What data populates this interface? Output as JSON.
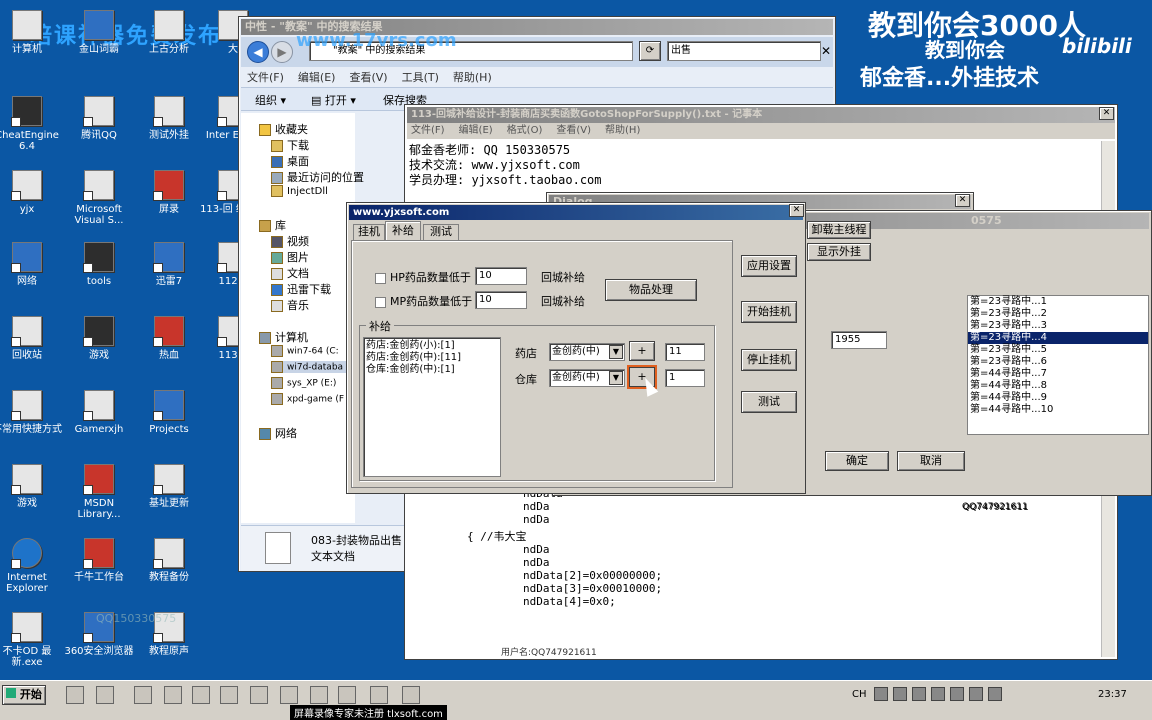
{
  "watermark": {
    "top_left": "培课神器免费发布",
    "top_right_1": "教到你会3000人",
    "top_right_2": "教到你会",
    "top_right_3": "郁金香...外挂技术",
    "bili": "bilibili",
    "center": "www.17vrs.com",
    "qq": "QQ150330575",
    "recorder": "屏幕录像专家未注册 tlxsoft.com"
  },
  "desktop": {
    "icons": [
      {
        "label": "计算机"
      },
      {
        "label": "金山词霸"
      },
      {
        "label": "上古分析"
      },
      {
        "label": "大"
      },
      {
        "label": "CheatEngine 6.4"
      },
      {
        "label": "腾讯QQ"
      },
      {
        "label": "测试外挂"
      },
      {
        "label": "Inter Explo"
      },
      {
        "label": "yjx"
      },
      {
        "label": "Microsoft Visual S..."
      },
      {
        "label": "屏录"
      },
      {
        "label": "113-回 给设计"
      },
      {
        "label": "网络"
      },
      {
        "label": "tools"
      },
      {
        "label": "迅雷7"
      },
      {
        "label": "112-0"
      },
      {
        "label": "回收站"
      },
      {
        "label": "游戏"
      },
      {
        "label": "热血"
      },
      {
        "label": "113-0"
      },
      {
        "label": "不常用快捷方式"
      },
      {
        "label": "Gamerxjh"
      },
      {
        "label": "Projects"
      },
      {
        "label": "游戏"
      },
      {
        "label": "MSDN Library..."
      },
      {
        "label": "基址更新"
      },
      {
        "label": "Internet Explorer"
      },
      {
        "label": "千牛工作台"
      },
      {
        "label": "教程备份"
      },
      {
        "label": "不卡OD 最新.exe"
      },
      {
        "label": "360安全浏览器"
      },
      {
        "label": "教程原声"
      }
    ]
  },
  "explorer": {
    "title": "中性 - \"教案\" 中的搜索结果",
    "address": "\"教案\" 中的搜索结果",
    "search_value": "出售",
    "menu": [
      "文件(F)",
      "编辑(E)",
      "查看(V)",
      "工具(T)",
      "帮助(H)"
    ],
    "toolbar": {
      "organize": "组织",
      "open": "打开",
      "save_search": "保存搜索"
    },
    "tree": {
      "favorites": "收藏夹",
      "downloads": "下载",
      "desktop": "桌面",
      "recent": "最近访问的位置",
      "injectdll": "InjectDll",
      "libraries": "库",
      "videos": "视频",
      "pictures": "图片",
      "documents": "文档",
      "thunder": "迅雷下载",
      "music": "音乐",
      "computer": "计算机",
      "win7_64": "win7-64 (C:",
      "wi7d": "wi7d-databa",
      "sysxp": "sys_XP (E:)",
      "xpd": "xpd-game (F",
      "network": "网络"
    },
    "file_name": "083-封装物品出售",
    "file_type": "文本文档"
  },
  "notepad": {
    "title": "113-回城补给设计-封装商店买卖函数GotoShopForSupply().txt - 记事本",
    "menu": [
      "文件(F)",
      "编辑(E)",
      "格式(O)",
      "查看(V)",
      "帮助(H)"
    ],
    "lines_top": [
      "郁金香老师: QQ 150330575",
      "技术交流: www.yjxsoft.com",
      "学员办理: yjxsoft.taobao.com"
    ],
    "lines_bottom": [
      "ndData",
      "ndDa",
      "ndDa",
      "{  //韦大宝",
      "ndDa",
      "ndDa",
      "ndData[2]=0x00000000;",
      "ndData[3]=0x00010000;",
      "ndData[4]=0x0;"
    ],
    "user": "用户名:QQ747921611"
  },
  "dialog_small": {
    "title": "Dialog"
  },
  "app_back": {
    "title": "0575",
    "buttons": {
      "unload": "卸载主线程",
      "show": "显示外挂"
    },
    "value_field": "1955",
    "list": [
      "第=23寻路中...1",
      "第=23寻路中...2",
      "第=23寻路中...3",
      "第=23寻路中...4",
      "第=23寻路中...5",
      "第=23寻路中...6",
      "第=44寻路中...7",
      "第=44寻路中...8",
      "第=44寻路中...9",
      "第=44寻路中...10"
    ],
    "ok": "确定",
    "cancel": "取消",
    "qq": "QQ747921611"
  },
  "main_dialog": {
    "title": "www.yjxsoft.com",
    "tabs": [
      "挂机",
      "补给",
      "测试"
    ],
    "hp_label": "HP药品数量低于",
    "hp_value": "10",
    "mp_label": "MP药品数量低于",
    "mp_value": "10",
    "return_label": "回城补给",
    "item_process": "物品处理",
    "group_label": "补给",
    "supply_list": [
      "药店:金创药(小):[1]",
      "药店:金创药(中):[11]",
      "仓库:金创药(中):[1]"
    ],
    "shop_label": "药店",
    "shop_combo": "金创药(中)",
    "shop_count": "11",
    "warehouse_label": "仓库",
    "warehouse_combo": "金创药(中)",
    "warehouse_count": "1",
    "plus": "+",
    "side_buttons": [
      "应用设置",
      "开始挂机",
      "停止挂机",
      "测试"
    ]
  },
  "taskbar": {
    "start": "开始",
    "lang": "CH",
    "clock": "23:37"
  }
}
